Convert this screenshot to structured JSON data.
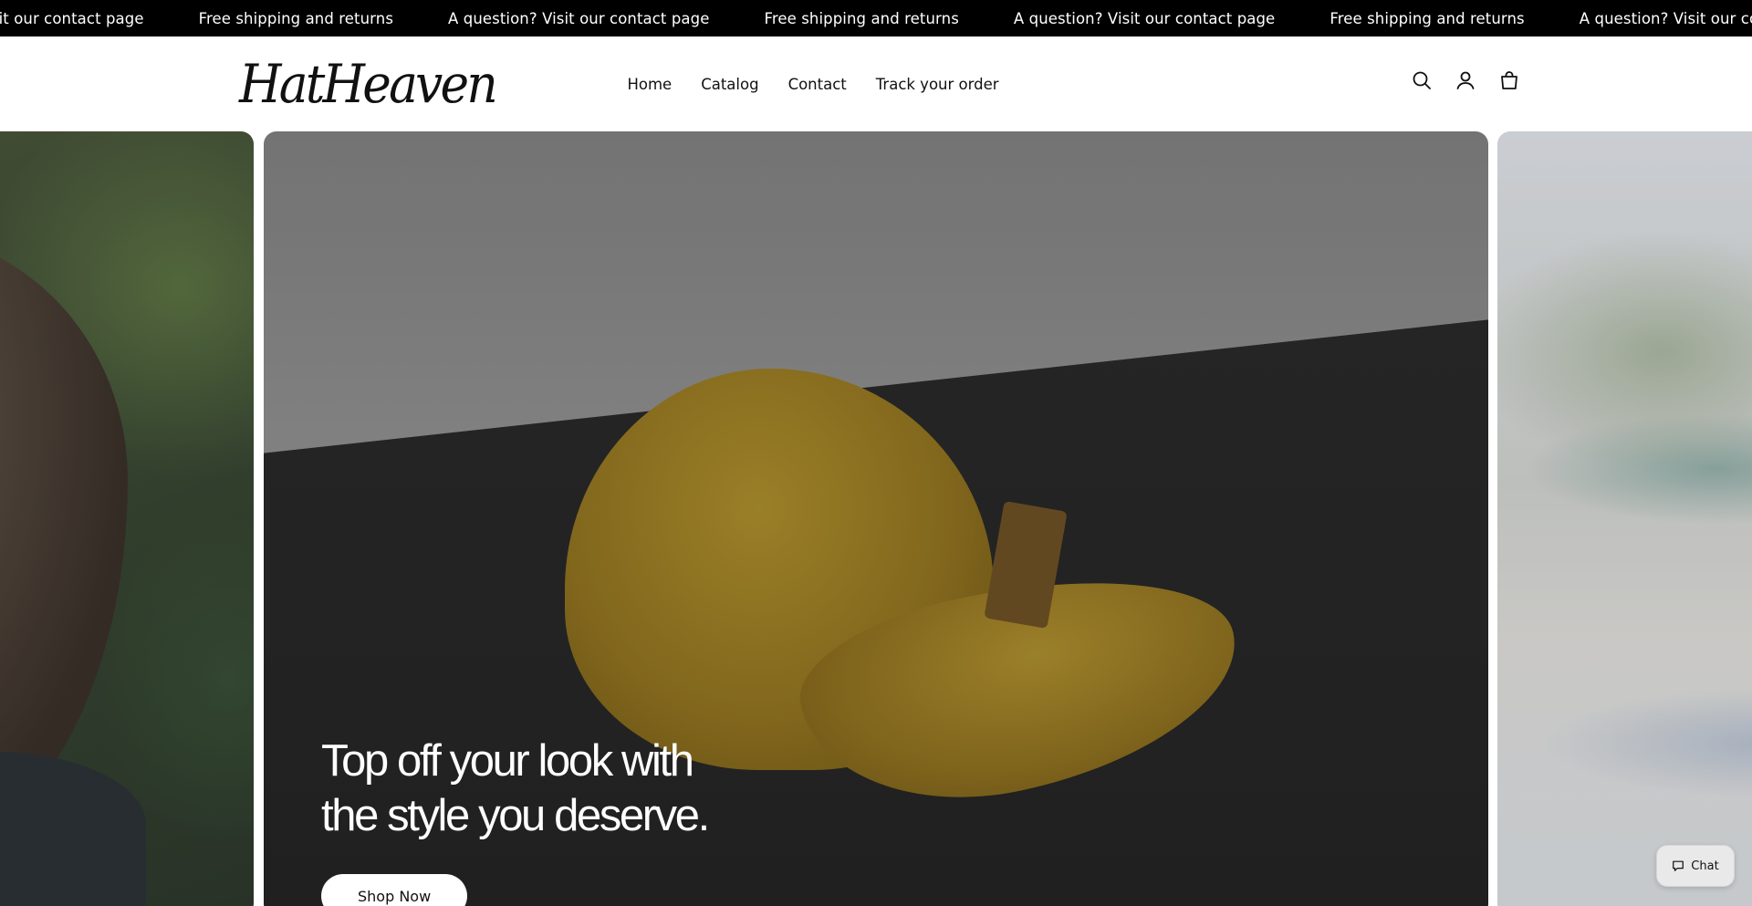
{
  "announcement": {
    "messages": [
      "? Visit our contact page",
      "Free shipping and returns",
      "A question? Visit our contact page",
      "Free shipping and returns",
      "A question? Visit our contact page",
      "Free shipping and returns",
      "A question? Visit our contact page"
    ]
  },
  "header": {
    "logo": "HatHeaven",
    "nav": [
      "Home",
      "Catalog",
      "Contact",
      "Track your order"
    ],
    "icons": [
      "search-icon",
      "account-icon",
      "cart-icon"
    ]
  },
  "hero": {
    "heading_line1": "Top off your look with",
    "heading_line2": "the style you deserve.",
    "cta": "Shop Now"
  },
  "chat": {
    "label": "Chat",
    "icon": "chat-bubble-icon"
  },
  "colors": {
    "announcement_bg": "#000000",
    "text": "#111111",
    "button_bg": "#ffffff"
  }
}
